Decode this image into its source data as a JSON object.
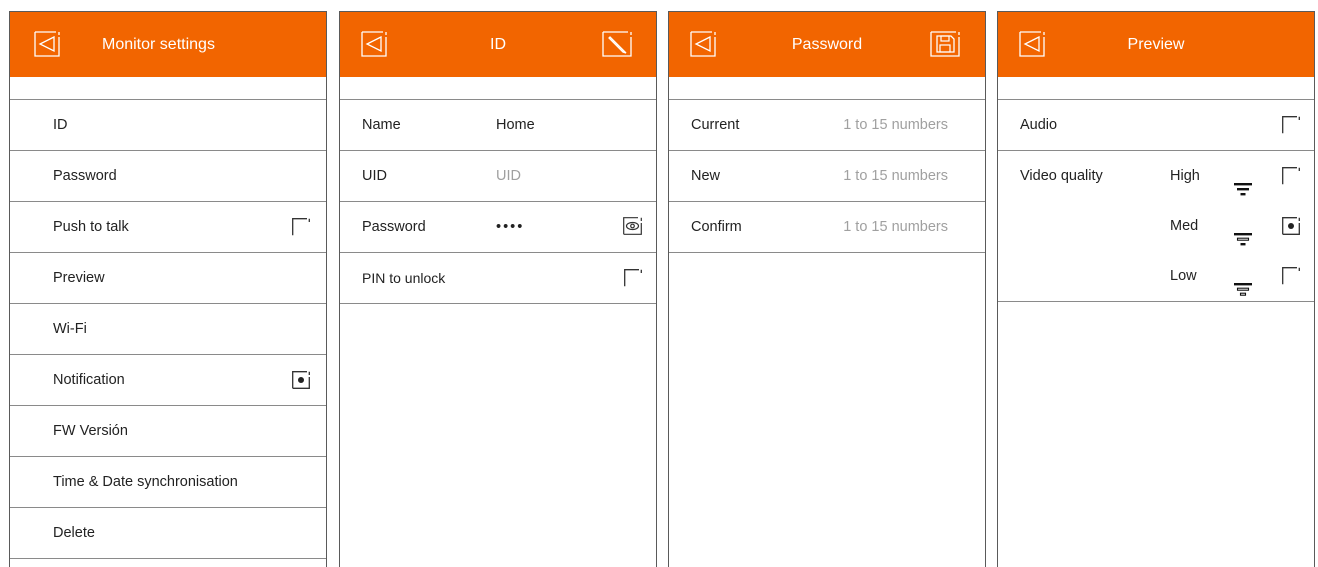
{
  "colors": {
    "header": "#f26500",
    "line": "#8a8a8a",
    "placeholder": "#a0a0a0"
  },
  "monitor_settings": {
    "title": "Monitor settings",
    "items": [
      {
        "label": "ID"
      },
      {
        "label": "Password"
      },
      {
        "label": "Push to talk",
        "checkbox": "unchecked"
      },
      {
        "label": "Preview"
      },
      {
        "label": "Wi-Fi"
      },
      {
        "label": "Notification",
        "checkbox": "checked"
      },
      {
        "label": "FW Versión"
      },
      {
        "label": "Time & Date synchronisation"
      },
      {
        "label": "Delete"
      }
    ]
  },
  "id_panel": {
    "title": "ID",
    "name_label": "Name",
    "name_value": "Home",
    "uid_label": "UID",
    "uid_placeholder": "UID",
    "password_label": "Password",
    "password_value": "••••",
    "pin_label": "PIN to unlock",
    "pin_checkbox": "unchecked"
  },
  "password_panel": {
    "title": "Password",
    "current_label": "Current",
    "new_label": "New",
    "confirm_label": "Confirm",
    "placeholder": "1 to 15 numbers"
  },
  "preview_panel": {
    "title": "Preview",
    "audio_label": "Audio",
    "audio_checkbox": "unchecked",
    "video_quality_label": "Video quality",
    "options": [
      {
        "label": "High",
        "checkbox": "unchecked",
        "icon": "filter-high-icon"
      },
      {
        "label": "Med",
        "checkbox": "checked",
        "icon": "filter-med-icon"
      },
      {
        "label": "Low",
        "checkbox": "unchecked",
        "icon": "filter-low-icon"
      }
    ]
  },
  "icons": {
    "back": "back-icon",
    "edit": "edit-icon",
    "save": "save-icon",
    "eye": "eye-icon"
  }
}
